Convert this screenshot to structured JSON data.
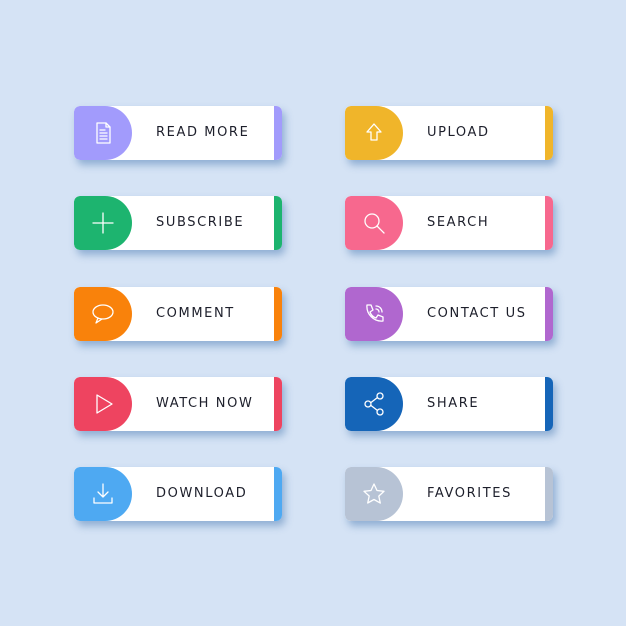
{
  "buttons": [
    {
      "label": "READ MORE",
      "icon": "document-icon",
      "color": "#a29bfc"
    },
    {
      "label": "SUBSCRIBE",
      "icon": "plus-icon",
      "color": "#1db46f"
    },
    {
      "label": "COMMENT",
      "icon": "speech-bubble-icon",
      "color": "#f9820b"
    },
    {
      "label": "WATCH NOW",
      "icon": "play-icon",
      "color": "#ee4460"
    },
    {
      "label": "DOWNLOAD",
      "icon": "download-icon",
      "color": "#4ea9f2"
    },
    {
      "label": "UPLOAD",
      "icon": "upload-arrow-icon",
      "color": "#f0b52a"
    },
    {
      "label": "SEARCH",
      "icon": "magnifier-icon",
      "color": "#f7688e"
    },
    {
      "label": "CONTACT US",
      "icon": "phone-icon",
      "color": "#b067cf"
    },
    {
      "label": "SHARE",
      "icon": "share-icon",
      "color": "#1565b8"
    },
    {
      "label": "FAVORITES",
      "icon": "star-icon",
      "color": "#b7c3d5"
    }
  ]
}
